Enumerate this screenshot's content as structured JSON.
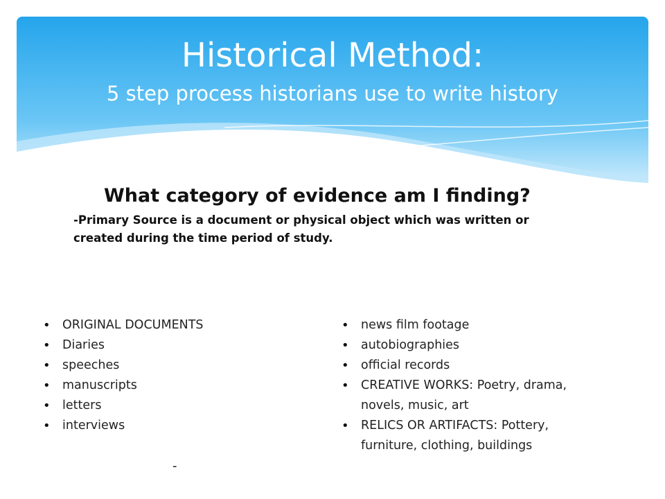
{
  "header": {
    "title": "Historical Method:",
    "subtitle": "5 step process historians use to write history",
    "colors": {
      "top": "#2aa8ec",
      "bottom": "#cbe9fb",
      "wave": "#ffffff"
    }
  },
  "question": "What category of evidence am I finding?",
  "definition": "-Primary Source is a document or physical object which was written or created during the time period of study.",
  "left_list": [
    "ORIGINAL DOCUMENTS",
    "Diaries",
    "speeches",
    "manuscripts",
    "letters",
    "interviews"
  ],
  "right_list": [
    "news film footage",
    "autobiographies",
    "official records",
    "CREATIVE WORKS: Poetry, drama, novels, music, art",
    "RELICS OR ARTIFACTS: Pottery, furniture, clothing, buildings"
  ],
  "trailing_mark": "-"
}
